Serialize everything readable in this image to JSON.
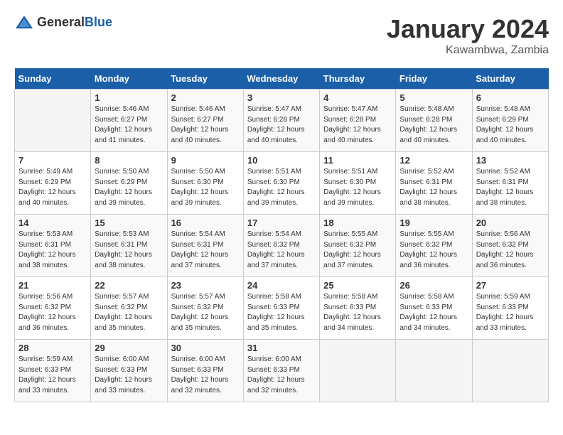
{
  "header": {
    "logo_general": "General",
    "logo_blue": "Blue",
    "month_year": "January 2024",
    "location": "Kawambwa, Zambia"
  },
  "days_of_week": [
    "Sunday",
    "Monday",
    "Tuesday",
    "Wednesday",
    "Thursday",
    "Friday",
    "Saturday"
  ],
  "weeks": [
    [
      {
        "day": "",
        "info": ""
      },
      {
        "day": "1",
        "info": "Sunrise: 5:46 AM\nSunset: 6:27 PM\nDaylight: 12 hours\nand 41 minutes."
      },
      {
        "day": "2",
        "info": "Sunrise: 5:46 AM\nSunset: 6:27 PM\nDaylight: 12 hours\nand 40 minutes."
      },
      {
        "day": "3",
        "info": "Sunrise: 5:47 AM\nSunset: 6:28 PM\nDaylight: 12 hours\nand 40 minutes."
      },
      {
        "day": "4",
        "info": "Sunrise: 5:47 AM\nSunset: 6:28 PM\nDaylight: 12 hours\nand 40 minutes."
      },
      {
        "day": "5",
        "info": "Sunrise: 5:48 AM\nSunset: 6:28 PM\nDaylight: 12 hours\nand 40 minutes."
      },
      {
        "day": "6",
        "info": "Sunrise: 5:48 AM\nSunset: 6:29 PM\nDaylight: 12 hours\nand 40 minutes."
      }
    ],
    [
      {
        "day": "7",
        "info": "Sunrise: 5:49 AM\nSunset: 6:29 PM\nDaylight: 12 hours\nand 40 minutes."
      },
      {
        "day": "8",
        "info": "Sunrise: 5:50 AM\nSunset: 6:29 PM\nDaylight: 12 hours\nand 39 minutes."
      },
      {
        "day": "9",
        "info": "Sunrise: 5:50 AM\nSunset: 6:30 PM\nDaylight: 12 hours\nand 39 minutes."
      },
      {
        "day": "10",
        "info": "Sunrise: 5:51 AM\nSunset: 6:30 PM\nDaylight: 12 hours\nand 39 minutes."
      },
      {
        "day": "11",
        "info": "Sunrise: 5:51 AM\nSunset: 6:30 PM\nDaylight: 12 hours\nand 39 minutes."
      },
      {
        "day": "12",
        "info": "Sunrise: 5:52 AM\nSunset: 6:31 PM\nDaylight: 12 hours\nand 38 minutes."
      },
      {
        "day": "13",
        "info": "Sunrise: 5:52 AM\nSunset: 6:31 PM\nDaylight: 12 hours\nand 38 minutes."
      }
    ],
    [
      {
        "day": "14",
        "info": "Sunrise: 5:53 AM\nSunset: 6:31 PM\nDaylight: 12 hours\nand 38 minutes."
      },
      {
        "day": "15",
        "info": "Sunrise: 5:53 AM\nSunset: 6:31 PM\nDaylight: 12 hours\nand 38 minutes."
      },
      {
        "day": "16",
        "info": "Sunrise: 5:54 AM\nSunset: 6:31 PM\nDaylight: 12 hours\nand 37 minutes."
      },
      {
        "day": "17",
        "info": "Sunrise: 5:54 AM\nSunset: 6:32 PM\nDaylight: 12 hours\nand 37 minutes."
      },
      {
        "day": "18",
        "info": "Sunrise: 5:55 AM\nSunset: 6:32 PM\nDaylight: 12 hours\nand 37 minutes."
      },
      {
        "day": "19",
        "info": "Sunrise: 5:55 AM\nSunset: 6:32 PM\nDaylight: 12 hours\nand 36 minutes."
      },
      {
        "day": "20",
        "info": "Sunrise: 5:56 AM\nSunset: 6:32 PM\nDaylight: 12 hours\nand 36 minutes."
      }
    ],
    [
      {
        "day": "21",
        "info": "Sunrise: 5:56 AM\nSunset: 6:32 PM\nDaylight: 12 hours\nand 36 minutes."
      },
      {
        "day": "22",
        "info": "Sunrise: 5:57 AM\nSunset: 6:32 PM\nDaylight: 12 hours\nand 35 minutes."
      },
      {
        "day": "23",
        "info": "Sunrise: 5:57 AM\nSunset: 6:32 PM\nDaylight: 12 hours\nand 35 minutes."
      },
      {
        "day": "24",
        "info": "Sunrise: 5:58 AM\nSunset: 6:33 PM\nDaylight: 12 hours\nand 35 minutes."
      },
      {
        "day": "25",
        "info": "Sunrise: 5:58 AM\nSunset: 6:33 PM\nDaylight: 12 hours\nand 34 minutes."
      },
      {
        "day": "26",
        "info": "Sunrise: 5:58 AM\nSunset: 6:33 PM\nDaylight: 12 hours\nand 34 minutes."
      },
      {
        "day": "27",
        "info": "Sunrise: 5:59 AM\nSunset: 6:33 PM\nDaylight: 12 hours\nand 33 minutes."
      }
    ],
    [
      {
        "day": "28",
        "info": "Sunrise: 5:59 AM\nSunset: 6:33 PM\nDaylight: 12 hours\nand 33 minutes."
      },
      {
        "day": "29",
        "info": "Sunrise: 6:00 AM\nSunset: 6:33 PM\nDaylight: 12 hours\nand 33 minutes."
      },
      {
        "day": "30",
        "info": "Sunrise: 6:00 AM\nSunset: 6:33 PM\nDaylight: 12 hours\nand 32 minutes."
      },
      {
        "day": "31",
        "info": "Sunrise: 6:00 AM\nSunset: 6:33 PM\nDaylight: 12 hours\nand 32 minutes."
      },
      {
        "day": "",
        "info": ""
      },
      {
        "day": "",
        "info": ""
      },
      {
        "day": "",
        "info": ""
      }
    ]
  ]
}
